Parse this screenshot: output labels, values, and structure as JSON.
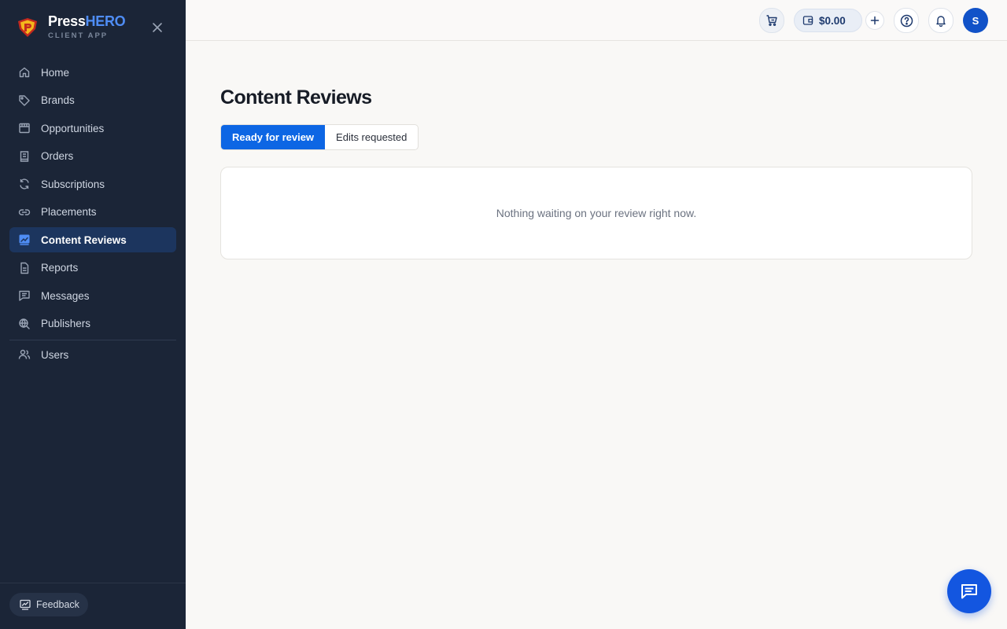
{
  "brand": {
    "name_part1": "Press",
    "name_part2": "HERO",
    "subtitle": "CLIENT APP"
  },
  "sidebar": {
    "items": [
      {
        "label": "Home",
        "icon": "home-icon"
      },
      {
        "label": "Brands",
        "icon": "tag-icon"
      },
      {
        "label": "Opportunities",
        "icon": "storefront-icon"
      },
      {
        "label": "Orders",
        "icon": "receipt-icon"
      },
      {
        "label": "Subscriptions",
        "icon": "refresh-icon"
      },
      {
        "label": "Placements",
        "icon": "link-icon"
      },
      {
        "label": "Content Reviews",
        "icon": "review-icon",
        "active": true
      },
      {
        "label": "Reports",
        "icon": "document-icon"
      },
      {
        "label": "Messages",
        "icon": "message-icon"
      },
      {
        "label": "Publishers",
        "icon": "globe-search-icon"
      }
    ],
    "users": {
      "label": "Users",
      "icon": "users-icon"
    },
    "feedback_label": "Feedback"
  },
  "topbar": {
    "balance": "$0.00",
    "avatar_initial": "S"
  },
  "main": {
    "title": "Content Reviews",
    "tabs": [
      {
        "label": "Ready for review",
        "active": true
      },
      {
        "label": "Edits requested",
        "active": false
      }
    ],
    "empty_message": "Nothing waiting on your review right now."
  },
  "colors": {
    "sidebar_bg": "#1b2537",
    "accent": "#0d66e4",
    "active_item_bg": "#1c355e"
  }
}
